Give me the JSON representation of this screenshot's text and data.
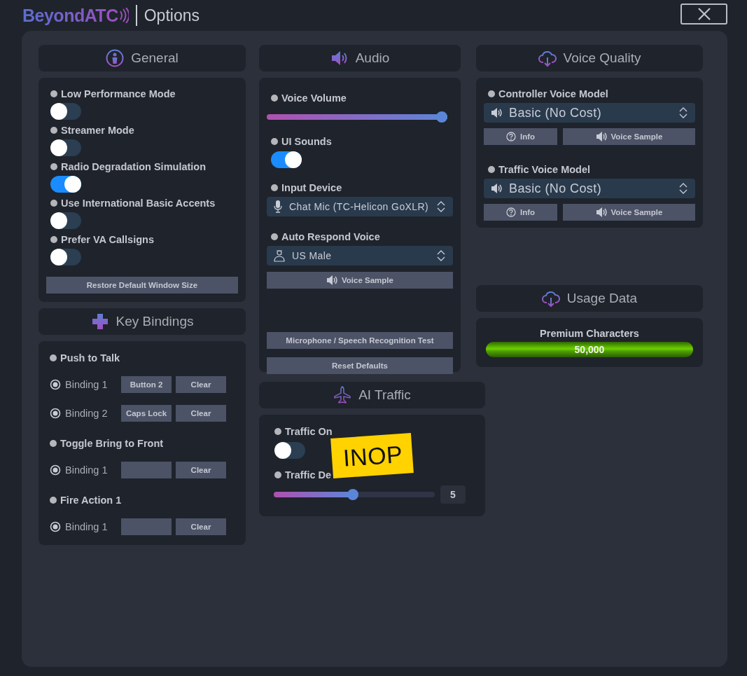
{
  "app": {
    "logo": "BeyondATC",
    "title": "Options"
  },
  "general": {
    "title": "General",
    "toggles": [
      {
        "label": "Low Performance Mode",
        "on": false
      },
      {
        "label": "Streamer Mode",
        "on": false
      },
      {
        "label": "Radio Degradation Simulation",
        "on": true
      },
      {
        "label": "Use International Basic Accents",
        "on": false
      },
      {
        "label": "Prefer VA Callsigns",
        "on": false
      }
    ],
    "button": "Restore Default Window Size"
  },
  "key_bindings": {
    "title": "Key Bindings",
    "actions": [
      {
        "name": "Push to Talk",
        "bindings": [
          {
            "label": "Binding 1",
            "key": "Button 2",
            "clear": "Clear"
          },
          {
            "label": "Binding 2",
            "key": "Caps Lock",
            "clear": "Clear"
          }
        ]
      },
      {
        "name": "Toggle Bring to Front",
        "bindings": [
          {
            "label": "Binding 1",
            "clear": "Clear"
          }
        ]
      },
      {
        "name": "Fire Action 1",
        "bindings": [
          {
            "label": "Binding 1",
            "clear": "Clear"
          }
        ]
      }
    ]
  },
  "audio": {
    "title": "Audio",
    "voice_volume": {
      "label": "Voice Volume",
      "level": 1
    },
    "ui_sounds": {
      "label": "UI Sounds",
      "on": true
    },
    "input_device": {
      "label": "Input Device",
      "value": "Chat Mic (TC-Helicon GoXLR)"
    },
    "auto_respond_voice": {
      "label": "Auto Respond Voice",
      "value": "US Male",
      "button": "Voice Sample"
    },
    "buttons": [
      "Microphone / Speech Recognition Test",
      "Reset Defaults"
    ]
  },
  "voice_quality": {
    "title": "Voice Quality",
    "models": [
      {
        "label": "Controller Voice Model",
        "value": "Basic (No Cost)",
        "info": "Info",
        "sample": "Voice Sample"
      },
      {
        "label": "Traffic Voice Model",
        "value": "Basic (No Cost)",
        "info": "Info",
        "sample": "Voice Sample"
      }
    ]
  },
  "usage_data": {
    "title": "Usage Data",
    "meter": {
      "label": "Premium Characters",
      "level": 1,
      "value": "50,000"
    }
  },
  "ai_traffic": {
    "title": "AI Traffic",
    "traffic_on": {
      "label": "Traffic On",
      "on": false
    },
    "density": {
      "label": "Traffic De",
      "level": 0.49,
      "value": "5"
    },
    "sticker": "INOP"
  }
}
